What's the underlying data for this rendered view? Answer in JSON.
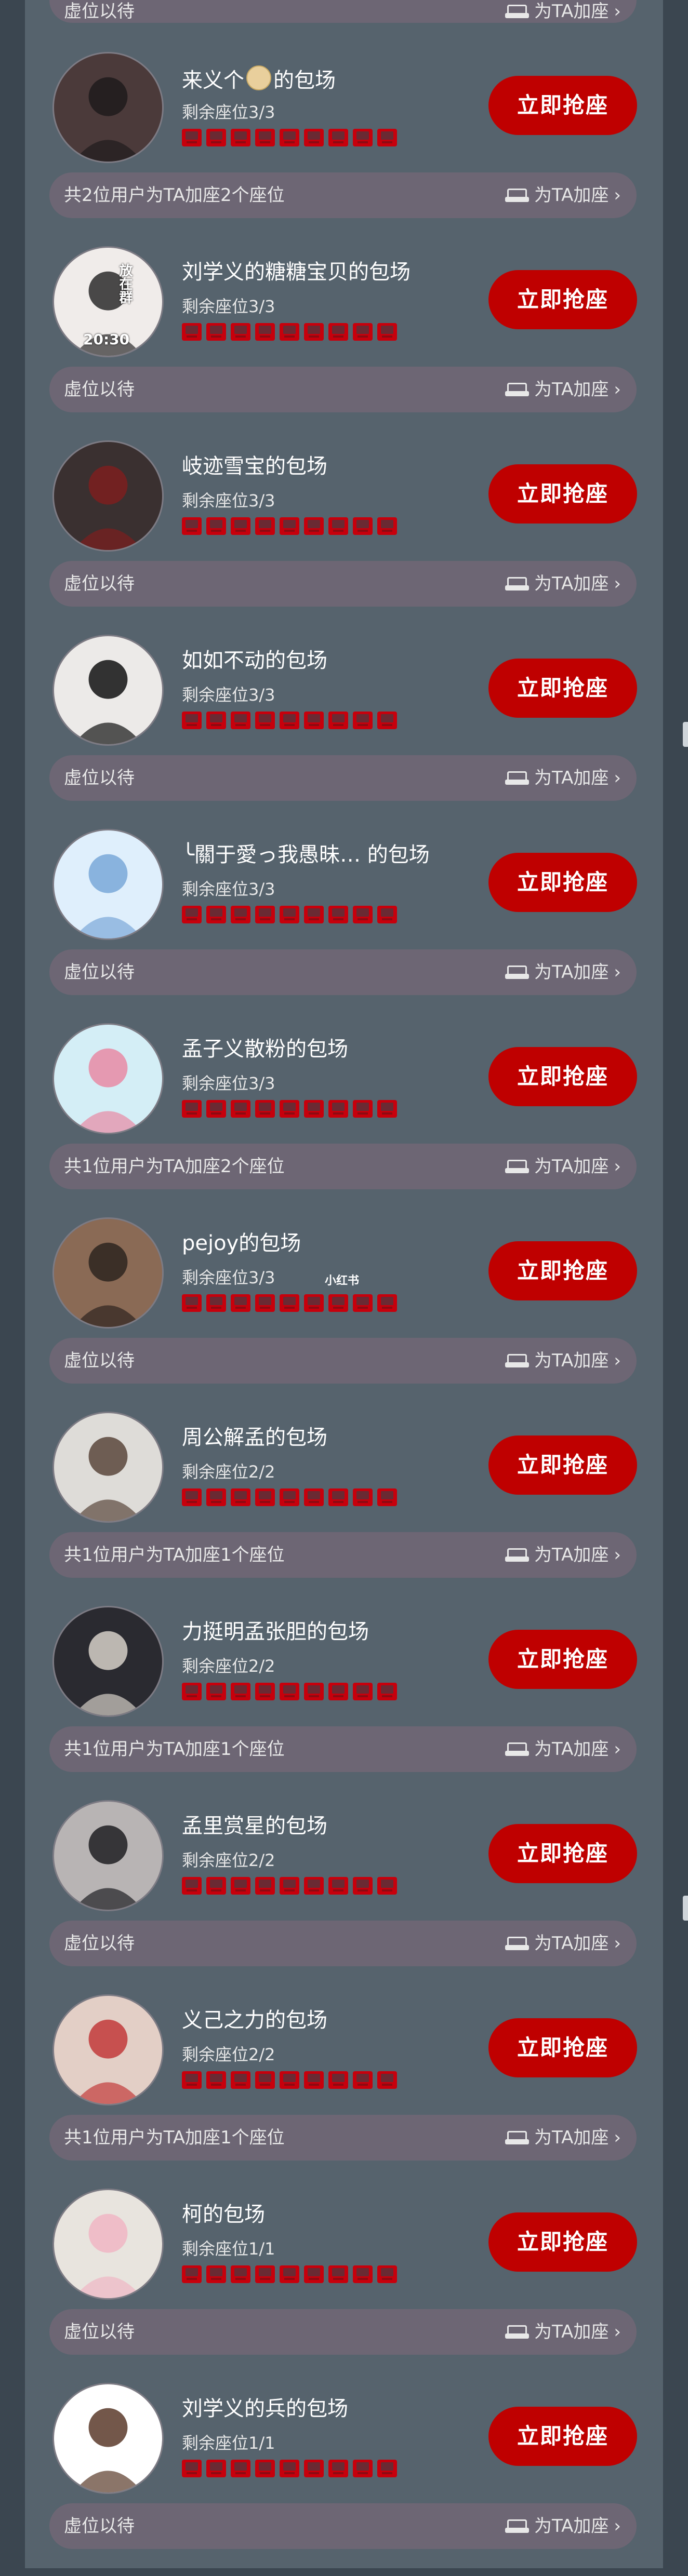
{
  "colors": {
    "background": "#3b4650",
    "panel": "#56636d",
    "bar": "#6d6674",
    "accent": "#bf0000",
    "seat": "#c7000c"
  },
  "top_bar": {
    "left": "虚位以待",
    "right": "为TA加座"
  },
  "icons": {
    "seat": "sofa-icon",
    "add": "sofa-icon",
    "chevron": "chevron-right-icon"
  },
  "cards": [
    {
      "title_before": "来义个",
      "title_after": "的包场",
      "has_emoji": true,
      "remain": "剩余座位3/3",
      "seat_count": 9,
      "button": "立即抢座",
      "bar_left": "共2位用户为TA加座2个座位",
      "bar_right": "为TA加座"
    },
    {
      "title": "刘学义的糖糖宝贝的包场",
      "remain": "剩余座位3/3",
      "seat_count": 9,
      "button": "立即抢座",
      "bar_left": "虚位以待",
      "bar_right": "为TA加座",
      "avatar_text": "放在群",
      "avatar_time": "20:30"
    },
    {
      "title": "岐迹雪宝的包场",
      "remain": "剩余座位3/3",
      "seat_count": 9,
      "button": "立即抢座",
      "bar_left": "虚位以待",
      "bar_right": "为TA加座"
    },
    {
      "title": "如如不动的包场",
      "remain": "剩余座位3/3",
      "seat_count": 9,
      "button": "立即抢座",
      "bar_left": "虚位以待",
      "bar_right": "为TA加座"
    },
    {
      "title": "╰關于愛っ我愚昧… 的包场",
      "remain": "剩余座位3/3",
      "seat_count": 9,
      "button": "立即抢座",
      "bar_left": "虚位以待",
      "bar_right": "为TA加座"
    },
    {
      "title": "孟子义散粉的包场",
      "remain": "剩余座位3/3",
      "seat_count": 9,
      "button": "立即抢座",
      "bar_left": "共1位用户为TA加座2个座位",
      "bar_right": "为TA加座"
    },
    {
      "title": "pejoy的包场",
      "remain": "剩余座位3/3",
      "seat_count": 9,
      "button": "立即抢座",
      "bar_left": "虚位以待",
      "bar_right": "为TA加座",
      "overlay": "小红书"
    },
    {
      "title": "周公解孟的包场",
      "remain": "剩余座位2/2",
      "seat_count": 9,
      "button": "立即抢座",
      "bar_left": "共1位用户为TA加座1个座位",
      "bar_right": "为TA加座"
    },
    {
      "title": "力挺明孟张胆的包场",
      "remain": "剩余座位2/2",
      "seat_count": 9,
      "button": "立即抢座",
      "bar_left": "共1位用户为TA加座1个座位",
      "bar_right": "为TA加座"
    },
    {
      "title": "孟里赏星的包场",
      "remain": "剩余座位2/2",
      "seat_count": 9,
      "button": "立即抢座",
      "bar_left": "虚位以待",
      "bar_right": "为TA加座"
    },
    {
      "title": "义己之力的包场",
      "remain": "剩余座位2/2",
      "seat_count": 9,
      "button": "立即抢座",
      "bar_left": "共1位用户为TA加座1个座位",
      "bar_right": "为TA加座"
    },
    {
      "title": "柯的包场",
      "remain": "剩余座位1/1",
      "seat_count": 9,
      "button": "立即抢座",
      "bar_left": "虚位以待",
      "bar_right": "为TA加座"
    },
    {
      "title": "刘学义的兵的包场",
      "remain": "剩余座位1/1",
      "seat_count": 9,
      "button": "立即抢座",
      "bar_left": "虚位以待",
      "bar_right": "为TA加座"
    }
  ]
}
